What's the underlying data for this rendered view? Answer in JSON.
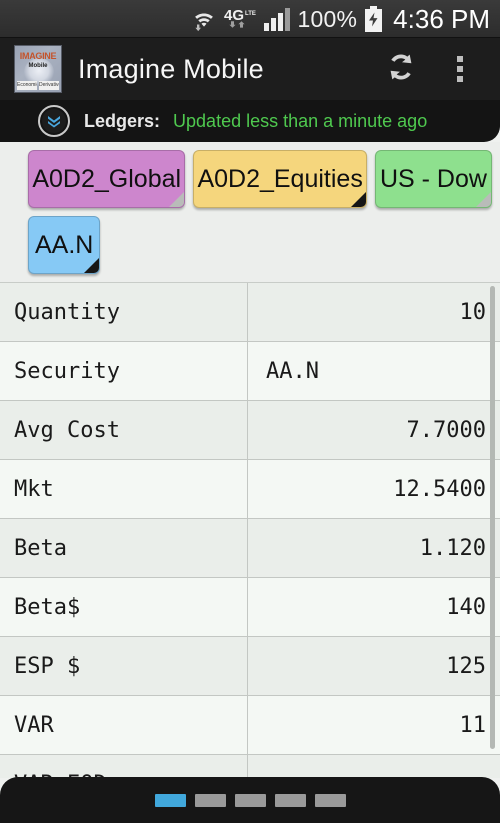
{
  "status_bar": {
    "wifi_icon": "wifi-icon",
    "network_icon": "4g-lte-icon",
    "network_label": "4G",
    "network_sub": "LTE",
    "signal_icon": "signal-bars-icon",
    "battery_percent": "100%",
    "battery_icon": "battery-charging-icon",
    "time": "4:36 PM"
  },
  "action_bar": {
    "logo": {
      "name": "imagine-mobile-logo",
      "line1": "IMAGINE",
      "line2": "Mobile",
      "chip_left": "Economic",
      "chip_right": "Derivatives"
    },
    "title": "Imagine Mobile",
    "refresh_icon": "refresh-icon",
    "overflow_icon": "overflow-menu-icon"
  },
  "ledgers_bar": {
    "expand_icon": "chevron-double-down-icon",
    "label": "Ledgers:",
    "status": "Updated less than a minute ago",
    "status_color": "#4fc94f"
  },
  "chips": [
    {
      "label": "A0D2_Global",
      "color": "#cd86cd",
      "fold": "light"
    },
    {
      "label": "A0D2_Equities",
      "color": "#f5d67d",
      "fold": "dark"
    },
    {
      "label": "US - Dow",
      "color": "#8ee08e",
      "fold": "light"
    },
    {
      "label": "AA.N",
      "color": "#86c9f5",
      "fold": "dark"
    }
  ],
  "detail_table": {
    "rows": [
      {
        "label": "Quantity",
        "value": "10",
        "align": "num"
      },
      {
        "label": "Security",
        "value": "AA.N",
        "align": "txt"
      },
      {
        "label": "Avg Cost",
        "value": "7.7000",
        "align": "num"
      },
      {
        "label": "Mkt",
        "value": "12.5400",
        "align": "num"
      },
      {
        "label": "Beta",
        "value": "1.120",
        "align": "num"
      },
      {
        "label": "Beta$",
        "value": "140",
        "align": "num"
      },
      {
        "label": "ESP $",
        "value": "125",
        "align": "num"
      },
      {
        "label": "VAR",
        "value": "11",
        "align": "num"
      },
      {
        "label": "VAR EOD",
        "value": "",
        "align": "num"
      }
    ]
  },
  "bottom_bar": {
    "pages": [
      {
        "active": true
      },
      {
        "active": false
      },
      {
        "active": false
      },
      {
        "active": false
      },
      {
        "active": false
      }
    ]
  }
}
